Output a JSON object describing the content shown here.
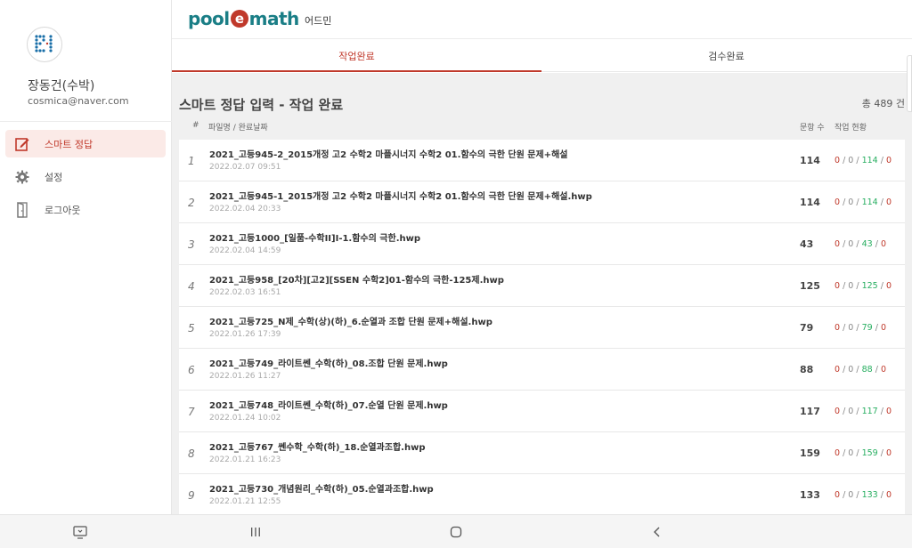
{
  "user": {
    "name": "장동건(수박)",
    "email": "cosmica@naver.com"
  },
  "nav": [
    {
      "label": "스마트 정답",
      "icon": "edit-icon",
      "active": true
    },
    {
      "label": "설정",
      "icon": "gear-icon",
      "active": false
    },
    {
      "label": "로그아웃",
      "icon": "door-icon",
      "active": false
    }
  ],
  "header": {
    "logo_pre": "pool",
    "logo_e": "e",
    "logo_post": "math",
    "subtitle": "어드민"
  },
  "tabs": [
    {
      "label": "작업완료",
      "active": true
    },
    {
      "label": "검수완료",
      "active": false
    }
  ],
  "main": {
    "title": "스마트 정답 입력 - 작업 완료",
    "total": "총 489 건",
    "columns": {
      "num": "#",
      "file": "파일명 / 완료날짜",
      "count": "문항 수",
      "status": "작업 현황"
    }
  },
  "rows": [
    {
      "num": "1",
      "file": "2021_고등945-2_2015개정 고2 수학2 마플시너지 수학2 01.함수의 극한 단원 문제+해설",
      "date": "2022.02.07 09:51",
      "count": "114",
      "s1": "0",
      "s2": "0",
      "s3": "114",
      "s4": "0"
    },
    {
      "num": "2",
      "file": "2021_고등945-1_2015개정 고2 수학2 마플시너지 수학2 01.함수의 극한 단원 문제+해설.hwp",
      "date": "2022.02.04 20:33",
      "count": "114",
      "s1": "0",
      "s2": "0",
      "s3": "114",
      "s4": "0"
    },
    {
      "num": "3",
      "file": "2021_고등1000_[일품-수학II]I-1.함수의 극한.hwp",
      "date": "2022.02.04 14:59",
      "count": "43",
      "s1": "0",
      "s2": "0",
      "s3": "43",
      "s4": "0"
    },
    {
      "num": "4",
      "file": "2021_고등958_[20차][고2][SSEN 수학2]01-함수의 극한-125제.hwp",
      "date": "2022.02.03 16:51",
      "count": "125",
      "s1": "0",
      "s2": "0",
      "s3": "125",
      "s4": "0"
    },
    {
      "num": "5",
      "file": "2021_고등725_N제_수학(상)(하)_6.순열과 조합 단원 문제+해설.hwp",
      "date": "2022.01.26 17:39",
      "count": "79",
      "s1": "0",
      "s2": "0",
      "s3": "79",
      "s4": "0"
    },
    {
      "num": "6",
      "file": "2021_고등749_라이트쎈_수학(하)_08.조합 단원 문제.hwp",
      "date": "2022.01.26 11:27",
      "count": "88",
      "s1": "0",
      "s2": "0",
      "s3": "88",
      "s4": "0"
    },
    {
      "num": "7",
      "file": "2021_고등748_라이트쎈_수학(하)_07.순열 단원 문제.hwp",
      "date": "2022.01.24 10:02",
      "count": "117",
      "s1": "0",
      "s2": "0",
      "s3": "117",
      "s4": "0"
    },
    {
      "num": "8",
      "file": "2021_고등767_쎈수학_수학(하)_18.순열과조합.hwp",
      "date": "2022.01.21 16:23",
      "count": "159",
      "s1": "0",
      "s2": "0",
      "s3": "159",
      "s4": "0"
    },
    {
      "num": "9",
      "file": "2021_고등730_개념원리_수학(하)_05.순열과조합.hwp",
      "date": "2022.01.21 12:55",
      "count": "133",
      "s1": "0",
      "s2": "0",
      "s3": "133",
      "s4": "0"
    }
  ],
  "colors": {
    "accent": "#c0392b",
    "teal": "#1a7e86",
    "green": "#27ae60"
  }
}
